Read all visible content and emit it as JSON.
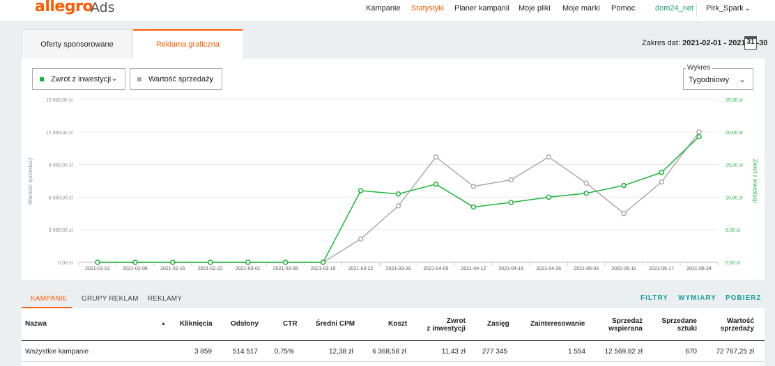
{
  "header": {
    "logo": "allegro",
    "logo_sub": "Ads",
    "nav": [
      "Kampanie",
      "Statystyki",
      "Planer kampanii",
      "Moje pliki",
      "Moje marki",
      "Pomoc"
    ],
    "account": "dom24_net",
    "user": "Pirk_Spark"
  },
  "tabs": [
    "Oferty sponsorowane",
    "Reklama graficzna"
  ],
  "date_range": {
    "label": "Zakres dat:",
    "value": "2021-02-01 - 2021-05-30",
    "calendar_day": "31"
  },
  "filters": {
    "metric1": "Zwrot z inwestycji",
    "metric2": "Wartość sprzedaży",
    "wykres_label": "Wykres",
    "wykres_value": "Tygodniowy"
  },
  "chart_data": {
    "type": "line",
    "categories": [
      "2021-02-01",
      "2021-02-08",
      "2021-02-15",
      "2021-02-22",
      "2021-03-01",
      "2021-03-08",
      "2021-03-15",
      "2021-03-22",
      "2021-03-29",
      "2021-04-05",
      "2021-04-12",
      "2021-04-19",
      "2021-04-26",
      "2021-05-03",
      "2021-05-10",
      "2021-05-17",
      "2021-05-24"
    ],
    "ylabel_left": "Wartość sprzedaży",
    "ylabel_right": "Zwrot z inwestycji",
    "ylim_left": [
      0,
      15000
    ],
    "ylim_right": [
      0,
      25
    ],
    "yticks_left": [
      "0,00 zł",
      "3 000,00 zł",
      "6 000,00 zł",
      "9 000,00 zł",
      "12 000,00 zł",
      "15 000,00 zł"
    ],
    "yticks_right": [
      "0,00 zł",
      "5,00 zł",
      "10,00 zł",
      "15,00 zł",
      "20,00 zł",
      "25,00 zł"
    ],
    "series": [
      {
        "name": "Wartość sprzedaży",
        "axis": "left",
        "color": "#aaaaaa",
        "values": [
          0,
          0,
          0,
          0,
          0,
          0,
          0,
          2150,
          5200,
          9700,
          7000,
          7600,
          9700,
          7300,
          4500,
          7400,
          12000
        ]
      },
      {
        "name": "Zwrot z inwestycji",
        "axis": "right",
        "color": "#1db338",
        "values": [
          0,
          0,
          0,
          0,
          0,
          0,
          0,
          11,
          10.5,
          12,
          8.5,
          9.2,
          10,
          10.6,
          11.8,
          13.8,
          19.3
        ]
      }
    ]
  },
  "lower_tabs": [
    "KAMPANIE",
    "GRUPY REKLAM",
    "REKLAMY"
  ],
  "actions": [
    "FILTRY",
    "WYMIARY",
    "POBIERZ"
  ],
  "table": {
    "headers": {
      "nazwa": "Nazwa",
      "klik": "Kliknięcia",
      "ods": "Odsłony",
      "ctr": "CTR",
      "cpm": "Średni CPM",
      "koszt": "Koszt",
      "zwrot1": "Zwrot",
      "zwrot2": "z inwestycji",
      "zasieg": "Zasięg",
      "zaint": "Zainteresowanie",
      "spw1": "Sprzedaż",
      "spw2": "wspierana",
      "sps1": "Sprzedane",
      "sps2": "sztuki",
      "wart1": "Wartość",
      "wart2": "sprzedaży"
    },
    "row": {
      "nazwa": "Wszystkie kampanie",
      "klik": "3 859",
      "ods": "514 517",
      "ctr": "0,75%",
      "cpm": "12,38 zł",
      "koszt": "6 368,58 zł",
      "zwrot": "11,43 zł",
      "zasieg": "277 345",
      "zaint": "1 554",
      "spw": "12 569,82 zł",
      "sps": "670",
      "wart": "72 767,25 zł"
    }
  }
}
